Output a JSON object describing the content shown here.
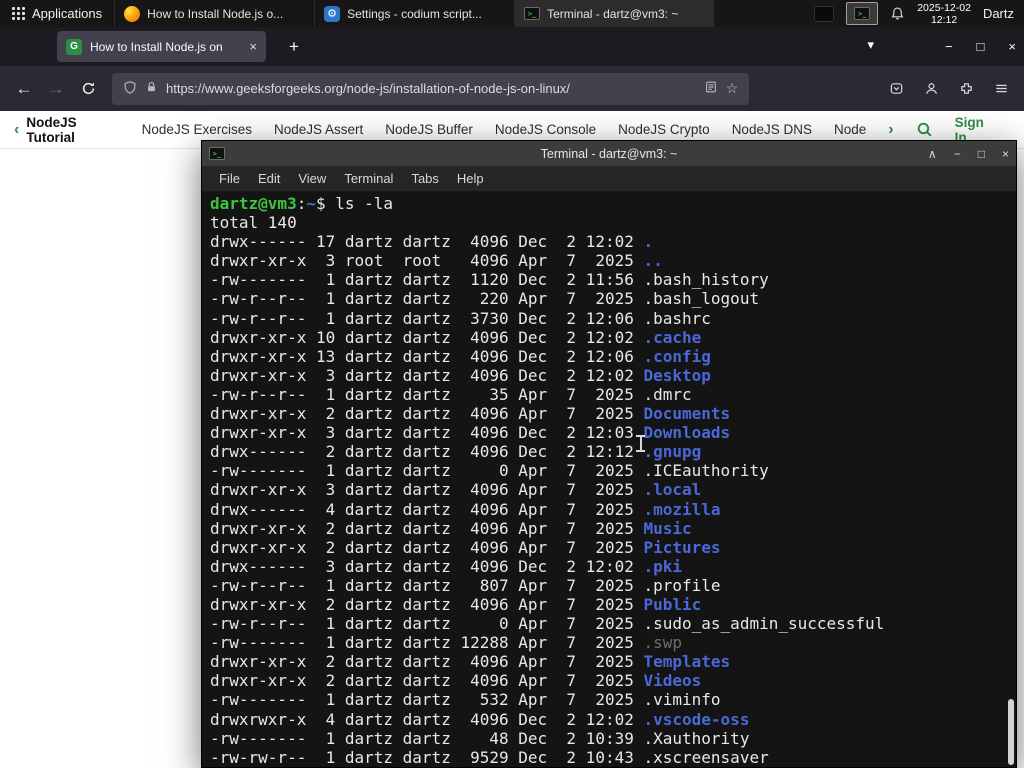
{
  "panel": {
    "applications_label": "Applications",
    "windows": [
      {
        "title": "How to Install Node.js o...",
        "icon": "firefox-icon"
      },
      {
        "title": "Settings - codium script...",
        "icon": "settings-icon"
      },
      {
        "title": "Terminal - dartz@vm3: ~",
        "icon": "terminal-icon"
      }
    ],
    "clock": {
      "date": "2025-12-02",
      "time": "12:12"
    },
    "user": "Dartz"
  },
  "browser": {
    "tab": {
      "title": "How to Install Node.js on"
    },
    "url": "https://www.geeksforgeeks.org/node-js/installation-of-node-js-on-linux/"
  },
  "site_nav": {
    "items": [
      "NodeJS Tutorial",
      "NodeJS Exercises",
      "NodeJS Assert",
      "NodeJS Buffer",
      "NodeJS Console",
      "NodeJS Crypto",
      "NodeJS DNS",
      "Node"
    ],
    "sign_in_label": "Sign In"
  },
  "terminal": {
    "window_title": "Terminal - dartz@vm3: ~",
    "menus": [
      "File",
      "Edit",
      "View",
      "Terminal",
      "Tabs",
      "Help"
    ],
    "prompt": {
      "user_host": "dartz@vm3",
      "colon": ":",
      "path": "~",
      "symbol": "$ ",
      "command": "ls -la"
    },
    "total_line": "total 140",
    "listing": [
      {
        "meta": "drwx------ 17 dartz dartz  4096 Dec  2 12:02 ",
        "name": ".",
        "type": "dir"
      },
      {
        "meta": "drwxr-xr-x  3 root  root   4096 Apr  7  2025 ",
        "name": "..",
        "type": "dir"
      },
      {
        "meta": "-rw-------  1 dartz dartz  1120 Dec  2 11:56 ",
        "name": ".bash_history",
        "type": "file"
      },
      {
        "meta": "-rw-r--r--  1 dartz dartz   220 Apr  7  2025 ",
        "name": ".bash_logout",
        "type": "file"
      },
      {
        "meta": "-rw-r--r--  1 dartz dartz  3730 Dec  2 12:06 ",
        "name": ".bashrc",
        "type": "file"
      },
      {
        "meta": "drwxr-xr-x 10 dartz dartz  4096 Dec  2 12:02 ",
        "name": ".cache",
        "type": "dir"
      },
      {
        "meta": "drwxr-xr-x 13 dartz dartz  4096 Dec  2 12:06 ",
        "name": ".config",
        "type": "dir"
      },
      {
        "meta": "drwxr-xr-x  3 dartz dartz  4096 Dec  2 12:02 ",
        "name": "Desktop",
        "type": "dir"
      },
      {
        "meta": "-rw-r--r--  1 dartz dartz    35 Apr  7  2025 ",
        "name": ".dmrc",
        "type": "file"
      },
      {
        "meta": "drwxr-xr-x  2 dartz dartz  4096 Apr  7  2025 ",
        "name": "Documents",
        "type": "dir"
      },
      {
        "meta": "drwxr-xr-x  3 dartz dartz  4096 Dec  2 12:03 ",
        "name": "Downloads",
        "type": "dir"
      },
      {
        "meta": "drwx------  2 dartz dartz  4096 Dec  2 12:12 ",
        "name": ".gnupg",
        "type": "dir"
      },
      {
        "meta": "-rw-------  1 dartz dartz     0 Apr  7  2025 ",
        "name": ".ICEauthority",
        "type": "file"
      },
      {
        "meta": "drwxr-xr-x  3 dartz dartz  4096 Apr  7  2025 ",
        "name": ".local",
        "type": "dir"
      },
      {
        "meta": "drwx------  4 dartz dartz  4096 Apr  7  2025 ",
        "name": ".mozilla",
        "type": "dir"
      },
      {
        "meta": "drwxr-xr-x  2 dartz dartz  4096 Apr  7  2025 ",
        "name": "Music",
        "type": "dir"
      },
      {
        "meta": "drwxr-xr-x  2 dartz dartz  4096 Apr  7  2025 ",
        "name": "Pictures",
        "type": "dir"
      },
      {
        "meta": "drwx------  3 dartz dartz  4096 Dec  2 12:02 ",
        "name": ".pki",
        "type": "dir"
      },
      {
        "meta": "-rw-r--r--  1 dartz dartz   807 Apr  7  2025 ",
        "name": ".profile",
        "type": "file"
      },
      {
        "meta": "drwxr-xr-x  2 dartz dartz  4096 Apr  7  2025 ",
        "name": "Public",
        "type": "dir"
      },
      {
        "meta": "-rw-r--r--  1 dartz dartz     0 Apr  7  2025 ",
        "name": ".sudo_as_admin_successful",
        "type": "file"
      },
      {
        "meta": "-rw-------  1 dartz dartz 12288 Apr  7  2025 ",
        "name": ".swp",
        "type": "dim"
      },
      {
        "meta": "drwxr-xr-x  2 dartz dartz  4096 Apr  7  2025 ",
        "name": "Templates",
        "type": "dir"
      },
      {
        "meta": "drwxr-xr-x  2 dartz dartz  4096 Apr  7  2025 ",
        "name": "Videos",
        "type": "dir"
      },
      {
        "meta": "-rw-------  1 dartz dartz   532 Apr  7  2025 ",
        "name": ".viminfo",
        "type": "file"
      },
      {
        "meta": "drwxrwxr-x  4 dartz dartz  4096 Dec  2 12:02 ",
        "name": ".vscode-oss",
        "type": "dir"
      },
      {
        "meta": "-rw-------  1 dartz dartz    48 Dec  2 10:39 ",
        "name": ".Xauthority",
        "type": "file"
      },
      {
        "meta": "-rw-rw-r--  1 dartz dartz  9529 Dec  2 10:43 ",
        "name": ".xscreensaver",
        "type": "file"
      }
    ]
  },
  "icons": {
    "gfg_glyph": "G",
    "term_glyph": ">_",
    "gear_glyph": "⚙",
    "plus": "+",
    "chevron_down": "▾",
    "chevron_up": "∧",
    "minimize": "−",
    "maximize": "□",
    "close": "×",
    "back": "←",
    "forward": "→",
    "nav_left": "‹",
    "nav_right": "›"
  },
  "colors": {
    "accent_green": "#2f8d46",
    "prompt_green": "#3fc43f",
    "dir_blue": "#4a68d8",
    "terminal_bg": "#141414",
    "panel_bg": "#161616"
  }
}
